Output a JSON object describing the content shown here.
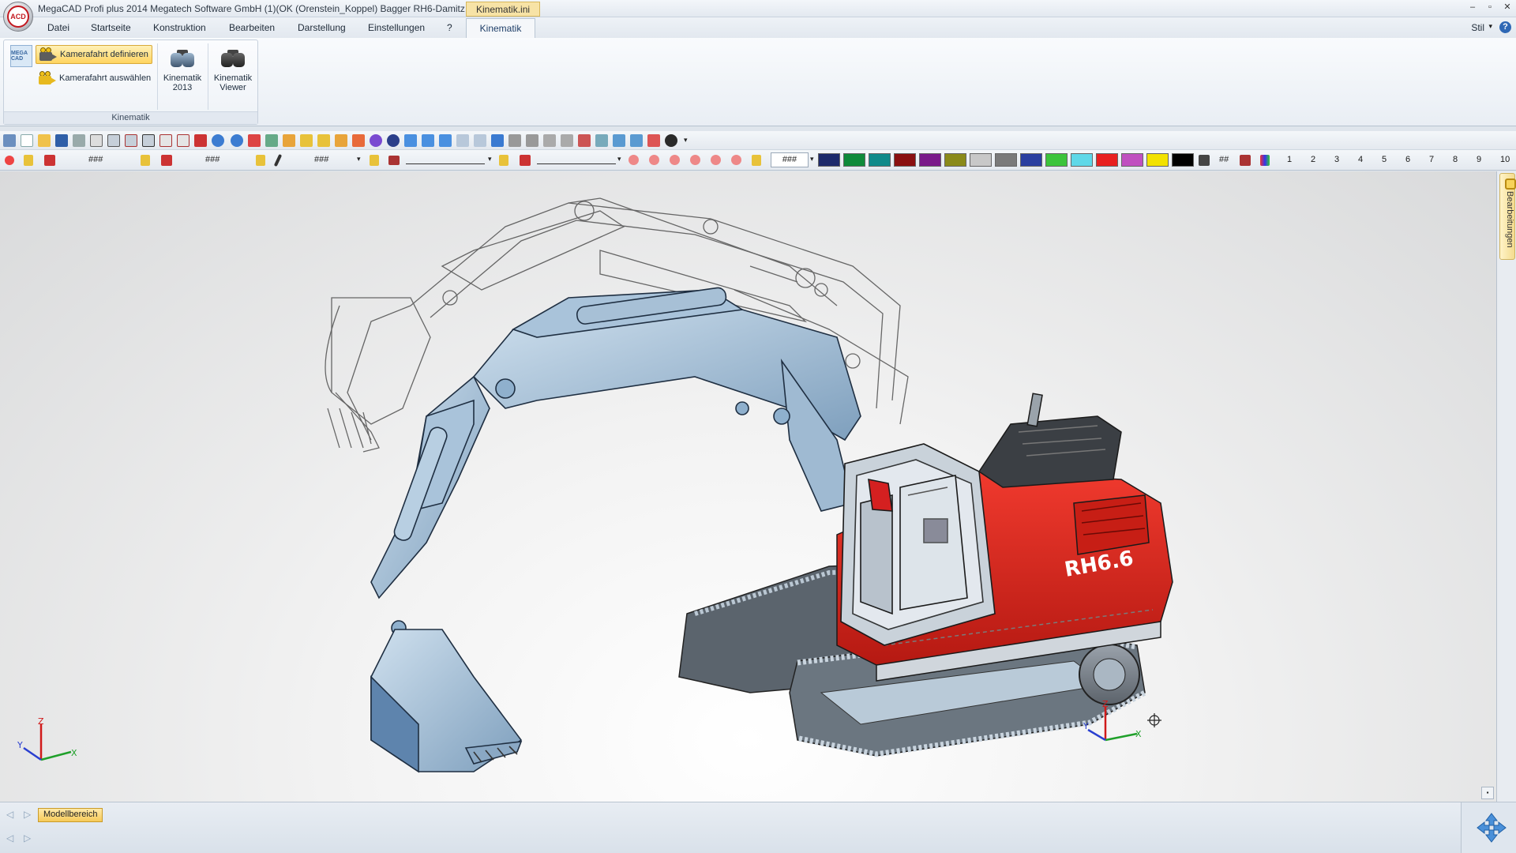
{
  "window": {
    "title": "MegaCAD Profi plus 2014  Megatech Software GmbH (1)(OK (Orenstein_Koppel) Bagger RH6-Damitz...",
    "file_tab": "Kinematik.ini",
    "logo_text": "MegaCAD",
    "controls": [
      "–",
      "▫",
      "✕"
    ]
  },
  "menu": {
    "items": [
      "Datei",
      "Startseite",
      "Konstruktion",
      "Bearbeiten",
      "Darstellung",
      "Einstellungen",
      "?"
    ],
    "active": "Kinematik",
    "stil": "Stil",
    "help": "?"
  },
  "ribbon": {
    "side_icon_text": "MEGA CAD",
    "kamerafahrt_definieren": "Kamerafahrt definieren",
    "kamerafahrt_auswaehlen": "Kamerafahrt auswählen",
    "kinematik_2013": [
      "Kinematik",
      "2013"
    ],
    "kinematik_viewer": [
      "Kinematik",
      "Viewer"
    ],
    "group_label": "Kinematik"
  },
  "toolbar2": {
    "field1": "###",
    "field2": "###",
    "field3": "###",
    "hash_box": "###",
    "grid_label": "##",
    "layers": [
      "1",
      "2",
      "3",
      "4",
      "5",
      "6",
      "7",
      "8",
      "9",
      "10"
    ],
    "colors": [
      "#1d2a6b",
      "#0f8a3a",
      "#0f8a8a",
      "#8a1010",
      "#7a1a8a",
      "#8a8a1a",
      "#c8c8c8",
      "#7a7a7a",
      "#2a3fa0",
      "#3cc43c",
      "#5fd8e8",
      "#e82020",
      "#c050c0",
      "#f2e200",
      "#000000"
    ]
  },
  "viewport": {
    "model_label": "RH6.6",
    "axis": {
      "x": "X",
      "y": "Y",
      "z": "Z"
    }
  },
  "side_panel": {
    "tab_label": "Bearbeitungen"
  },
  "bottom": {
    "model_tab": "Modellbereich"
  }
}
